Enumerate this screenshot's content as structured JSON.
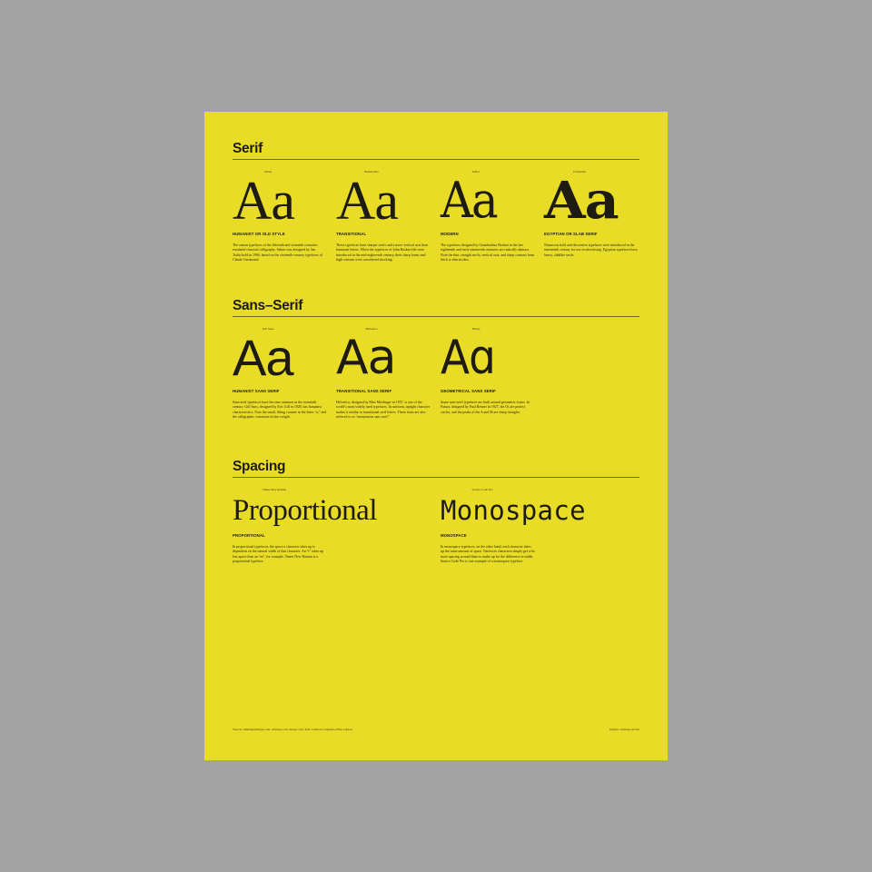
{
  "serif": {
    "title": "Serif",
    "items": [
      {
        "font": "Sabon",
        "glyph": "Aa",
        "category": "HUMANIST OR OLD STYLE",
        "description": "The roman typefaces of the fifteenth and sixteenth centuries emulated classical calligraphy. Sabon was designed by Jan Tschichold in 1966, based on the sixteenth-century typefaces of Claude Garamond."
      },
      {
        "font": "Baskerville",
        "glyph": "Aa",
        "category": "TRANSITIONAL",
        "description": "These typefaces have sharper serifs and a more vertical axis than humanist letters. When the typefaces of John Baskerville were introduced in the mid-eighteenth century, their sharp forms and high contrast were considered shocking."
      },
      {
        "font": "Didot",
        "glyph": "Aa",
        "category": "MODERN",
        "description": "The typefaces designed by Giambattista Bodoni in the late eighteenth and early nineteenth centuries are radically abstract. Note the thin, straight serifs; vertical axis; and sharp contrast from thick to thin strokes."
      },
      {
        "font": "Clarendon",
        "glyph": "Aa",
        "category": "EGYPTIAN OR SLAB SERIF",
        "description": "Numerous bold and decorative typefaces were introduced in the nineteenth century for use in advertising. Egyptian typefaces have heavy, slablike serifs."
      }
    ]
  },
  "sans": {
    "title": "Sans–Serif",
    "items": [
      {
        "font": "Gill Sans",
        "glyph": "Aa",
        "category": "HUMANIST SANS SERIF",
        "description": "Sans-serif typefaces have become common in the twentieth century. Gill Sans, designed by Eric Gill in 1928, has humanist characteristics. Note the small, lilting counter in the letter “a,” and the calligraphic variations in line weight."
      },
      {
        "font": "Helvetica",
        "glyph": "Aa",
        "category": "TRANSITIONAL SANS SERIF",
        "description": "Helvetica, designed by Max Miedinger in 1957, is one of the world’s most widely used typefaces. Its uniform, upright character makes it similar to transitional serif letters. These fonts are also referred to as “anonymous sans serif”."
      },
      {
        "font": "Futura",
        "glyph": "Aɑ",
        "category": "GEOMETRICAL SANS SERIF",
        "description": "Some sans-serif typefaces are built around geometric forms. In Futura, designed by Paul Renner in 1927, the Os are perfect circles, and the peaks of the A and M are sharp triangles."
      }
    ]
  },
  "spacing": {
    "title": "Spacing",
    "items": [
      {
        "font": "Times New Roman",
        "sample": "Proportional",
        "category": "PROPORTIONAL",
        "description": "In proportional typefaces, the space a character takes up is dependent on the natural width of that character. An “i” takes up less space than an “m”, for example. Times New Roman is a proportional typeface."
      },
      {
        "font": "Source Code Pro",
        "sample": "Monospace",
        "category": "MONOSPACE",
        "description": "In monospace typefaces, on the other hand, each character takes up the same amount of space. Narrower characters simply get a bit more spacing around them to make up for the difference in width. Source Code Pro is one example of a monospace typeface."
      }
    ]
  },
  "footer": {
    "sources": "Sources: thinkingwithtype.com, wtmtype.com, myspo.com. Text: Cameron Chapman, Ellen Lupton.",
    "credit": "Design: Johannes Adolet"
  }
}
